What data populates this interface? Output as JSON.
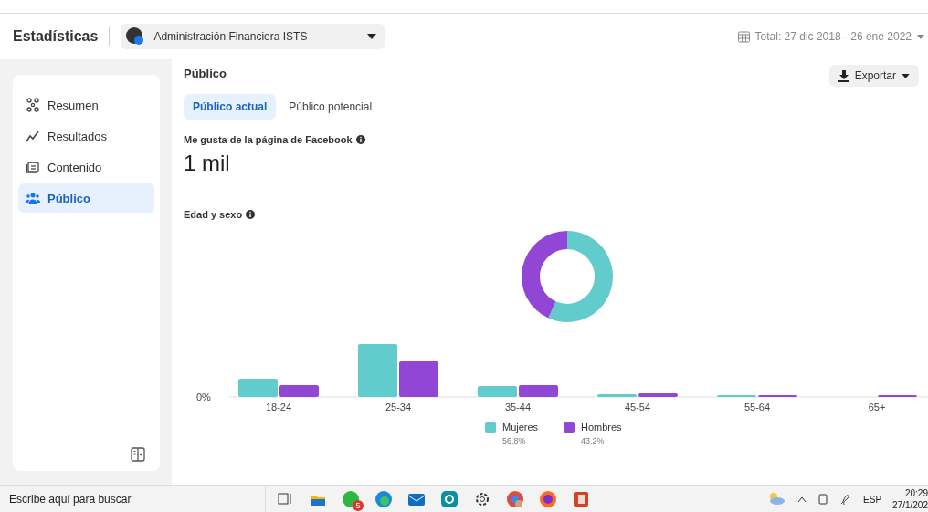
{
  "header": {
    "title": "Estadísticas",
    "page_selector": "Administración Financiera ISTS",
    "date_range": "Total: 27 dic 2018 - 26 ene 2022"
  },
  "sidebar": {
    "items": [
      {
        "label": "Resumen",
        "selected": false
      },
      {
        "label": "Resultados",
        "selected": false
      },
      {
        "label": "Contenido",
        "selected": false
      },
      {
        "label": "Público",
        "selected": true
      }
    ]
  },
  "main": {
    "title": "Público",
    "export_button": "Exportar",
    "tabs": [
      {
        "label": "Público actual",
        "selected": true
      },
      {
        "label": "Público potencial",
        "selected": false
      }
    ],
    "likes": {
      "label": "Me gusta de la página de Facebook",
      "value": "1 mil"
    },
    "age_gender": {
      "label": "Edad y sexo",
      "chart_data": {
        "type": "donut",
        "categories": [
          "Mujeres",
          "Hombres"
        ],
        "values": [
          56.8,
          43.2
        ]
      },
      "bar_axis": {
        "zero_label": "0%",
        "categories": [
          "18-24",
          "25-34",
          "35-44",
          "45-54",
          "55-64",
          "65+"
        ]
      },
      "legend": [
        {
          "share": "56,8%",
          "color": "#62cbcb"
        },
        {
          "share": "43,2%",
          "color": "#9146d6"
        }
      ]
    }
  },
  "taskbar": {
    "search_placeholder": "Escribe aquí para buscar",
    "chat_badge": "5",
    "language": "ESP",
    "time": "20:29",
    "date": "27/1/202"
  }
}
